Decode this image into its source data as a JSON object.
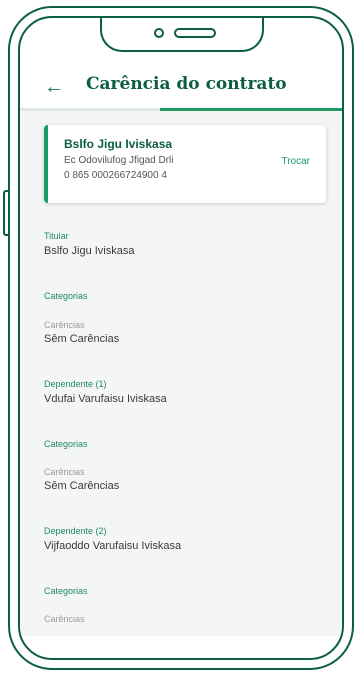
{
  "header": {
    "back_icon": "arrow-left-icon",
    "title": "Carência do contrato"
  },
  "contract_card": {
    "name": "Bslfo Jigu Iviskasa",
    "line1": "Ec Odovilufog Jfigad Drli",
    "line2": "0 865 000266724900 4",
    "action": "Trocar"
  },
  "sections": [
    {
      "role_label": "Titular",
      "person": "Bslfo Jigu Iviskasa"
    },
    {
      "categories_label": "Categorias",
      "field_label": "Carências",
      "field_value": "Sêm Carências"
    },
    {
      "role_label": "Dependente (1)",
      "person": "Vdufai Varufaisu Iviskasa"
    },
    {
      "categories_label": "Categorias",
      "field_label": "Carências",
      "field_value": "Sêm Carências"
    },
    {
      "role_label": "Dependente (2)",
      "person": "Vijfaoddo Varufaisu Iviskasa"
    },
    {
      "categories_label": "Categorias",
      "field_label": "Carências"
    }
  ],
  "colors": {
    "brand_dark": "#0b5d43",
    "accent": "#1d9a65"
  }
}
